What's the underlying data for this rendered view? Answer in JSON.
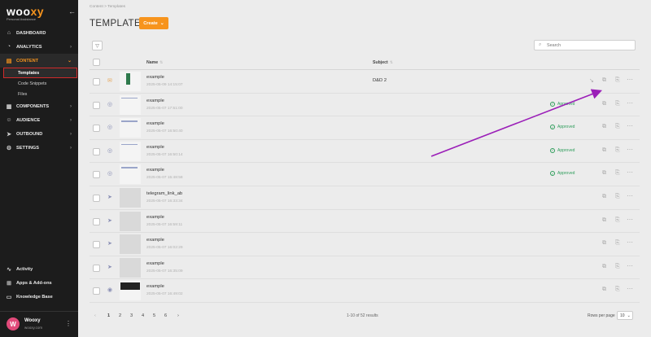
{
  "sidebar": {
    "logo": "woo",
    "logo_accent": "xy",
    "logo_sub": "Personal Assistance",
    "nav": [
      {
        "label": "DASHBOARD"
      },
      {
        "label": "ANALYTICS"
      },
      {
        "label": "CONTENT"
      },
      {
        "label": "COMPONENTS"
      },
      {
        "label": "AUDIENCE"
      },
      {
        "label": "OUTBOUND"
      },
      {
        "label": "SETTINGS"
      }
    ],
    "content_sub": [
      "Templates",
      "Code Snippets",
      "Files"
    ],
    "bottom": [
      {
        "label": "Activity"
      },
      {
        "label": "Apps & Add-ons"
      },
      {
        "label": "Knowledge Base"
      }
    ],
    "profile": {
      "initial": "W",
      "name": "Wooxy",
      "email": "wooxy.com"
    }
  },
  "header": {
    "breadcrumb": "Content  >  Templates",
    "title": "TEMPLATES",
    "create_label": "Create",
    "search_placeholder": "Search"
  },
  "table": {
    "headers": {
      "name": "Name",
      "subject": "Subject"
    },
    "rows": [
      {
        "name": "example",
        "date": "2025-05-09 14:15:07",
        "subject": "D&D 2",
        "status": ""
      },
      {
        "name": "example",
        "date": "2025-05-07 17:51:00",
        "subject": "",
        "status": "Approved"
      },
      {
        "name": "example",
        "date": "2025-05-07 16:50:40",
        "subject": "",
        "status": "Approved"
      },
      {
        "name": "example",
        "date": "2025-05-07 16:50:14",
        "subject": "",
        "status": "Approved"
      },
      {
        "name": "example",
        "date": "2025-05-07 15:48:58",
        "subject": "",
        "status": "Approved"
      },
      {
        "name": "telegram_link_ab",
        "date": "2025-05-07 16:33:34",
        "subject": "",
        "status": ""
      },
      {
        "name": "example",
        "date": "2025-05-07 16:59:11",
        "subject": "",
        "status": ""
      },
      {
        "name": "example",
        "date": "2025-05-07 16:02:29",
        "subject": "",
        "status": ""
      },
      {
        "name": "example",
        "date": "2025-05-07 16:35:09",
        "subject": "",
        "status": ""
      },
      {
        "name": "example",
        "date": "2025-05-07 16:49:02",
        "subject": "",
        "status": ""
      }
    ]
  },
  "pagination": {
    "pages": [
      "1",
      "2",
      "3",
      "4",
      "5",
      "6"
    ],
    "prev": "‹",
    "next": "›",
    "results": "1-10 of 52 results",
    "rows_per_page_label": "Rows per page",
    "rows_per_page_value": "10"
  },
  "colors": {
    "accent": "#f7941d",
    "approved": "#2e9d5b",
    "annotation_arrow": "#9b1fb8"
  }
}
